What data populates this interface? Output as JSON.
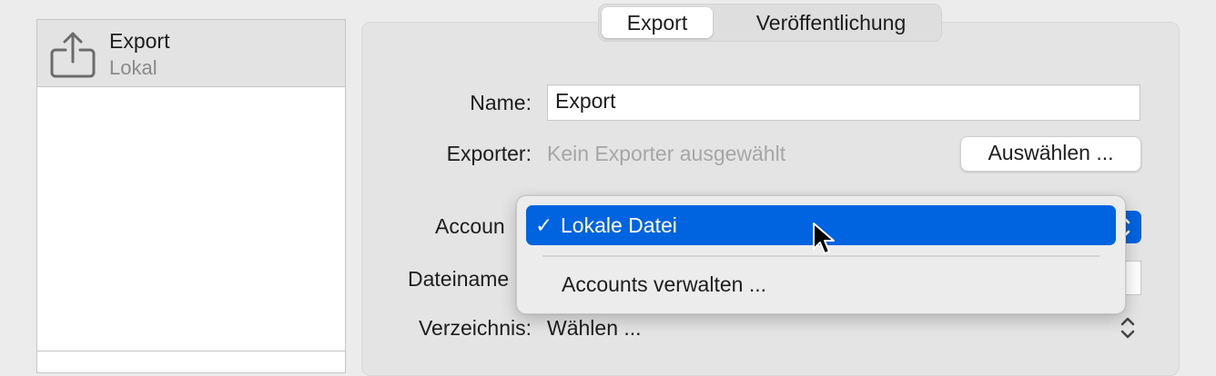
{
  "sidebar": {
    "items": [
      {
        "title": "Export",
        "subtitle": "Lokal",
        "icon": "share-export-icon"
      }
    ]
  },
  "tabs": [
    {
      "label": "Export",
      "active": true
    },
    {
      "label": "Veröffentlichung",
      "active": false
    }
  ],
  "form": {
    "name_label": "Name:",
    "name_value": "Export",
    "exporter_label": "Exporter:",
    "exporter_value": "Kein Exporter ausgewählt",
    "exporter_button": "Auswählen ...",
    "account_label": "Accoun",
    "filename_label": "Dateiname",
    "directory_label": "Verzeichnis:",
    "directory_value": "Wählen ..."
  },
  "account_menu": {
    "selected": {
      "check": "✓",
      "label": "Lokale Datei"
    },
    "items": [
      {
        "label": "Accounts verwalten ..."
      }
    ]
  },
  "colors": {
    "accent": "#0064e1",
    "window_bg": "#ececec",
    "panel_bg": "#e4e4e4",
    "placeholder_text": "#a6a6a6"
  }
}
